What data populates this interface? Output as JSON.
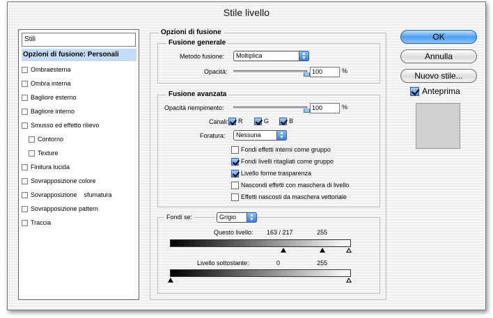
{
  "window": {
    "title": "Stile livello"
  },
  "sidebar": {
    "field_label": "Stili",
    "items": [
      {
        "label": "Opzioni di fusione: Personali",
        "selected": true
      },
      {
        "label": "Ombraesterna"
      },
      {
        "label": "Ombra interna"
      },
      {
        "label": "Bagliore esterno"
      },
      {
        "label": "Bagliore interno"
      },
      {
        "label": "Smusso ed effetto rilievo"
      },
      {
        "label": "Contorno"
      },
      {
        "label": "Texture"
      },
      {
        "label": "Finitura lucida"
      },
      {
        "label": "Sovrapposizione colore"
      },
      {
        "label": "Sovrapposizione    sfumatura"
      },
      {
        "label": "Sovrapposizione pattern"
      },
      {
        "label": "Traccia"
      }
    ]
  },
  "blending": {
    "title": "Opzioni di fusione",
    "general": {
      "title": "Fusione generale",
      "mode_label": "Metodo fusione:",
      "mode_value": "Moltiplica",
      "opacity_label": "Opacità:",
      "opacity_value": "100",
      "opacity_fraction": 1.0,
      "percent": "%"
    },
    "advanced": {
      "title": "Fusione avanzata",
      "fill_label": "Opacità riempimento:",
      "fill_value": "100",
      "fill_fraction": 1.0,
      "percent": "%",
      "channels_label": "Canali:",
      "channel_r": "R",
      "channel_g": "G",
      "channel_b": "B",
      "knockout_label": "Foratura:",
      "knockout_value": "Nessuna",
      "options": [
        {
          "label": "Fondi effetti interni come gruppo",
          "checked": false
        },
        {
          "label": "Fondi livelli ritagliati come gruppo",
          "checked": true
        },
        {
          "label": "Livello forme trasparenza",
          "checked": true
        },
        {
          "label": "Nascondi effetti con maschera di livello",
          "checked": false
        },
        {
          "label": "Effetti nascosti da maschera vettoriale",
          "checked": false
        }
      ]
    },
    "blend_if": {
      "label": "Fondi se:",
      "value": "Grigio",
      "this_layer_label": "Questo livello:",
      "this_layer_low": "163 / 217",
      "this_layer_high": "255",
      "underlying_label": "Livello sottostante:",
      "underlying_low": "0",
      "underlying_high": "255"
    }
  },
  "buttons": {
    "ok": "OK",
    "cancel": "Annulla",
    "new_style": "Nuovo stile...",
    "preview": "Anteprima"
  },
  "colors": {
    "accent": "#4f9cf0",
    "selection": "#c4dbf7",
    "preview_swatch": "#d0d0d0"
  }
}
